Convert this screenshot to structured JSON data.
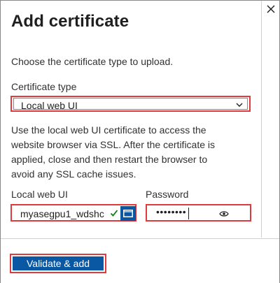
{
  "dialog": {
    "title": "Add certificate",
    "intro_text": "Choose the certificate type to upload."
  },
  "certificate_type": {
    "label": "Certificate type",
    "selected": "Local web UI"
  },
  "description": "Use the local web UI certificate to access the website browser via SSL. After the certificate is applied, close and then restart the browser to avoid any SSL cache issues.",
  "file_field": {
    "label": "Local web UI",
    "value": "myasegpu1_wdshc"
  },
  "password_field": {
    "label": "Password",
    "masked_value": "••••••••"
  },
  "footer": {
    "primary_button": "Validate & add"
  },
  "colors": {
    "accent": "#0a57a4",
    "highlight": "#e0393e",
    "success": "#107c10"
  },
  "icons": [
    "close-icon",
    "chevron-down-icon",
    "checkmark-icon",
    "folder-icon",
    "eye-icon"
  ]
}
